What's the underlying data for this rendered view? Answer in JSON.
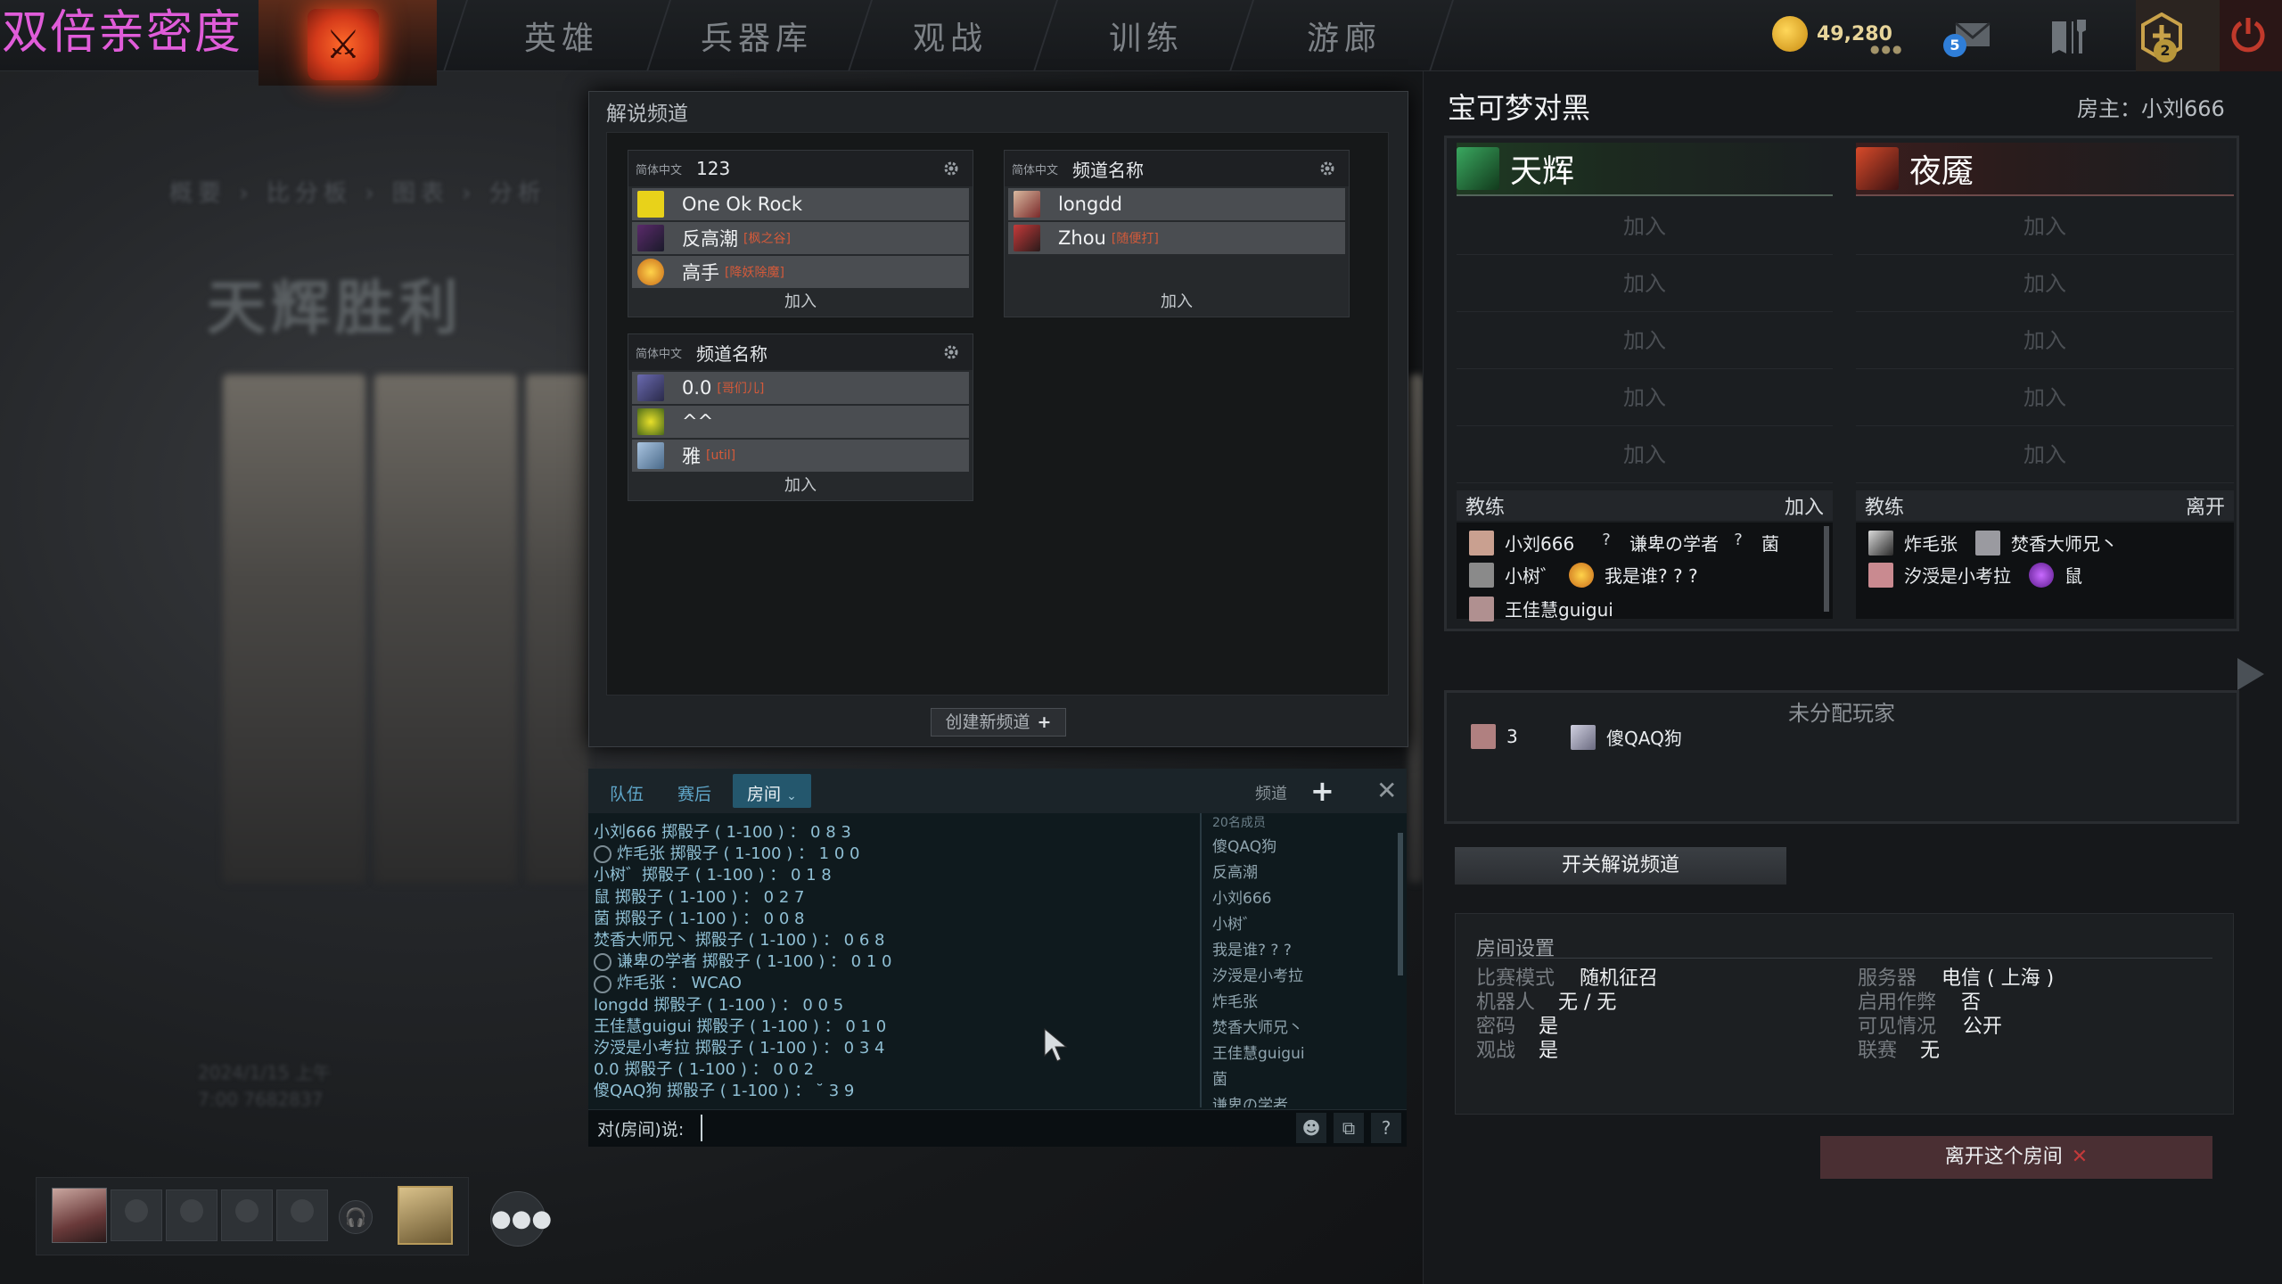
{
  "overlay_title": "双倍亲密度",
  "nav": {
    "items": [
      "英雄",
      "兵器库",
      "观战",
      "训练",
      "游廊"
    ],
    "gold": "49,280",
    "mail_badge": "5",
    "quest_badge": "2"
  },
  "background": {
    "breadcrumb": "概要 › 比分板 › 图表 › 分析",
    "victory_text": "天辉胜利",
    "date_text": "2024/1/15 上午\n7:00 7682837"
  },
  "commentary": {
    "title": "解说频道",
    "channels": [
      {
        "lang": "简体中文",
        "name": "123",
        "rows": [
          {
            "name": "One Ok Rock",
            "tag": ""
          },
          {
            "name": "反高潮",
            "tag": "[枫之谷]"
          },
          {
            "name": "高手",
            "tag": "[降妖除魔]"
          }
        ],
        "join": "加入"
      },
      {
        "lang": "简体中文",
        "name": "频道名称",
        "rows": [
          {
            "name": "longdd",
            "tag": ""
          },
          {
            "name": "Zhou",
            "tag": "[随便打]"
          }
        ],
        "join": "加入"
      },
      {
        "lang": "简体中文",
        "name": "频道名称",
        "rows": [
          {
            "name": "0.0",
            "tag": "[哥们儿]"
          },
          {
            "name": "^^",
            "tag": ""
          },
          {
            "name": "雅",
            "tag": "[util]"
          }
        ],
        "join": "加入"
      }
    ],
    "create_label": "创建新频道"
  },
  "chat": {
    "tabs": [
      "队伍",
      "赛后",
      "房间"
    ],
    "channel_label": "频道",
    "messages": [
      {
        "icon": false,
        "text": "小刘666 掷骰子 ( 1-100 ) ： 0 8 3"
      },
      {
        "icon": true,
        "text": "炸毛张 掷骰子 ( 1-100 ) ： 1 0 0"
      },
      {
        "icon": false,
        "text": "小树゛掷骰子 ( 1-100 ) ： 0 1 8"
      },
      {
        "icon": false,
        "text": "鼠 掷骰子 ( 1-100 ) ： 0 2 7"
      },
      {
        "icon": false,
        "text": "菌 掷骰子 ( 1-100 ) ： 0 0 8"
      },
      {
        "icon": false,
        "text": "焚香大师兄丶 掷骰子 ( 1-100 ) ： 0 6 8"
      },
      {
        "icon": true,
        "text": "谦卑の学者 掷骰子 ( 1-100 ) ： 0 1 0"
      },
      {
        "icon": true,
        "text": "炸毛张 ： WCAO"
      },
      {
        "icon": false,
        "text": "longdd 掷骰子 ( 1-100 ) ： 0 0 5"
      },
      {
        "icon": false,
        "text": "王佳慧guigui 掷骰子 ( 1-100 ) ： 0 1 0"
      },
      {
        "icon": false,
        "text": "汐涭是小考拉 掷骰子 ( 1-100 ) ： 0 3 4"
      },
      {
        "icon": false,
        "text": "0.0 掷骰子 ( 1-100 ) ： 0 0 2"
      },
      {
        "icon": false,
        "text": "傻QAQ狗 掷骰子 ( 1-100 ) ： ˘ 3 9"
      }
    ],
    "member_count": "20名成员",
    "members": [
      "傻QAQ狗",
      "反高潮",
      "小刘666",
      "小树゛",
      "我是谁? ? ?",
      "汐涭是小考拉",
      "炸毛张",
      "焚香大师兄丶",
      "王佳慧guigui",
      "菌",
      "谦卑の学者"
    ],
    "input_label": "对(房间)说:",
    "input_value": ""
  },
  "lobby": {
    "title": "宝可梦对黑",
    "host": "房主：小刘666",
    "radiant": {
      "name": "天辉",
      "slots": [
        "加入",
        "加入",
        "加入",
        "加入",
        "加入"
      ],
      "coach_label": "教练",
      "coach_action": "加入",
      "spectators": [
        "小刘666",
        "谦卑の学者",
        "菌",
        "小树゛",
        "我是谁? ? ?",
        "王佳慧guigui"
      ]
    },
    "dire": {
      "name": "夜魇",
      "slots": [
        "加入",
        "加入",
        "加入",
        "加入",
        "加入"
      ],
      "coach_label": "教练",
      "coach_action": "离开",
      "spectators": [
        "炸毛张",
        "焚香大师兄丶",
        "汐涭是小考拉",
        "鼠"
      ]
    },
    "unassigned_title": "未分配玩家",
    "unassigned": [
      "3",
      "傻QAQ狗"
    ],
    "toggle_button": "开关解说频道",
    "settings": {
      "title": "房间设置",
      "rows": [
        {
          "label": "比赛模式",
          "value": "随机征召"
        },
        {
          "label": "机器人",
          "value": "无 / 无"
        },
        {
          "label": "密码",
          "value": "是"
        },
        {
          "label": "观战",
          "value": "是"
        },
        {
          "label": "服务器",
          "value": "电信 ( 上海 )"
        },
        {
          "label": "启用作弊",
          "value": "否"
        },
        {
          "label": "可见情况",
          "value": "公开"
        },
        {
          "label": "联赛",
          "value": "无"
        }
      ]
    },
    "leave_button": "离开这个房间"
  },
  "colors": {
    "radiant": "#1f3b23",
    "dire": "#3b1e1e",
    "chat_accent": "#24576d",
    "gold": "#e8d59a"
  }
}
